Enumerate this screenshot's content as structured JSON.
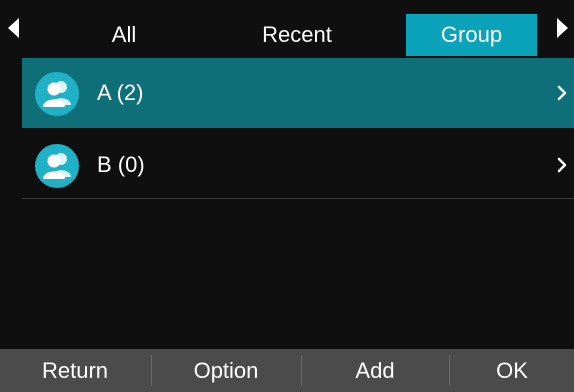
{
  "tabs": {
    "items": [
      {
        "label": "All",
        "selected": false
      },
      {
        "label": "Recent",
        "selected": false
      },
      {
        "label": "Group",
        "selected": true
      }
    ],
    "prev_icon": "left-triangle-icon",
    "next_icon": "right-triangle-icon"
  },
  "groups": [
    {
      "name": "A (2)",
      "icon": "group-avatar-icon",
      "selected": true
    },
    {
      "name": "B (0)",
      "icon": "group-avatar-icon",
      "selected": false
    }
  ],
  "softkeys": {
    "return": "Return",
    "option": "Option",
    "add": "Add",
    "ok": "OK"
  },
  "colors": {
    "background": "#0f0f0f",
    "tab_selected": "#0aa3b9",
    "row_selected": "#0e6f79",
    "avatar": "#1fb2c6",
    "softkey_bar": "#4b4b4b",
    "text": "#ffffff"
  }
}
